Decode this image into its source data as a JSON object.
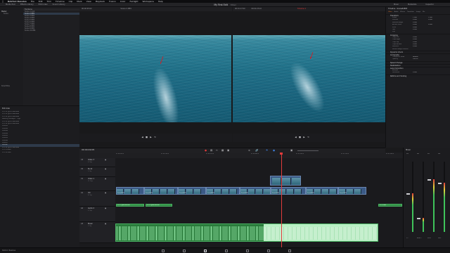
{
  "menubar": {
    "app_name": "DaVinci Resolve",
    "items": [
      "File",
      "Edit",
      "Trim",
      "Timeline",
      "Clip",
      "Mark",
      "View",
      "Playback",
      "Fusion",
      "Color",
      "Fairlight",
      "Workspace",
      "Help"
    ]
  },
  "toolbar": {
    "left": [
      "Media Pool",
      "Effects Library",
      "Edit Index",
      "Sound Library"
    ],
    "project_title": "My First Edit",
    "project_status": "Edited",
    "right": [
      "Mixer",
      "Metadata",
      "Inspector"
    ]
  },
  "media_pool": {
    "bins": [
      "Master",
      "Scene"
    ],
    "smart_bins_label": "Smart Bins",
    "column_header": "File Name",
    "clips": [
      "Scene 1.mp4",
      "Scene 2.MP4",
      "Scene 3.MP4",
      "Scene 4.MP4",
      "Scene 5.MP4",
      "Scene 6.MP4",
      "Scene 7.MP4",
      "Scene 8.MP4",
      "Scene 9.MP4",
      "Scene 10.MP4"
    ],
    "selected_index": 1
  },
  "edit_index": {
    "title": "Edit Index",
    "rows": [
      "PTC 01 good take.wav",
      "PTC 01 good take.wav",
      "PTC 02 good take.wav",
      "Leaving Verzegni - Trigo",
      "PTC 01 good take.wav",
      "PTC 02 good take.wav",
      "Scene3",
      "Scene2",
      "Scene6",
      "Scene4",
      "Scene5",
      "Scene1",
      "Scene8",
      "Scene7",
      "Shore1",
      "PTC 02 good take.wav",
      "PTC 03.wav",
      "PTC 01.wav"
    ],
    "selected_index": 14
  },
  "viewer": {
    "source_timecode": "00:00:05:02",
    "source_clip": "Scene 2.MP4",
    "program_timecode_left": "00:01:17:00",
    "program_timecode_right": "00:01:23:22",
    "program_label": "Timeline 1",
    "timeline_timecode": "00:00:49:05",
    "fit_zoom": "Fit"
  },
  "inspector": {
    "title": "Timeline - Scene6.MP4",
    "tabs": [
      "Video",
      "Audio",
      "Effects",
      "Transition",
      "Image",
      "File"
    ],
    "sections": [
      {
        "name": "Transform",
        "rows": [
          {
            "label": "Zoom",
            "x": "1.000",
            "y": "1.000"
          },
          {
            "label": "Position",
            "x": "0.000",
            "y": "0.000"
          },
          {
            "label": "Rotation Angle",
            "x": "0.000",
            "y": ""
          },
          {
            "label": "Anchor Point",
            "x": "0.000",
            "y": "0.000"
          },
          {
            "label": "Pitch",
            "x": "0.000",
            "y": ""
          },
          {
            "label": "Yaw",
            "x": "0.000",
            "y": ""
          },
          {
            "label": "Flip",
            "x": "",
            "y": ""
          }
        ]
      },
      {
        "name": "Cropping",
        "rows": [
          {
            "label": "Crop Left",
            "x": "0.000",
            "y": ""
          },
          {
            "label": "Crop Right",
            "x": "0.000",
            "y": ""
          },
          {
            "label": "Crop Top",
            "x": "0.000",
            "y": ""
          },
          {
            "label": "Crop Bottom",
            "x": "0.000",
            "y": ""
          },
          {
            "label": "Softness",
            "x": "0.000",
            "y": ""
          },
          {
            "label": "Retain Image Position",
            "x": "",
            "y": ""
          }
        ]
      },
      {
        "name": "Dynamic Zoom",
        "rows": []
      },
      {
        "name": "Composite",
        "rows": [
          {
            "label": "Composite Mode",
            "x": "Normal",
            "y": ""
          },
          {
            "label": "Opacity",
            "x": "100.00",
            "y": ""
          }
        ]
      },
      {
        "name": "Speed Change",
        "rows": []
      },
      {
        "name": "Stabilization",
        "rows": []
      },
      {
        "name": "Lens Correction",
        "rows": [
          {
            "label": "Analyze",
            "x": "",
            "y": ""
          },
          {
            "label": "Distortion",
            "x": "0.000",
            "y": ""
          }
        ]
      },
      {
        "name": "Retime and Scaling",
        "rows": []
      }
    ]
  },
  "timeline": {
    "ruler": [
      "01:00:00:00",
      "01:00:16:00",
      "01:00:32:00",
      "01:00:48:00",
      "01:01:04:00",
      "01:01:20:00",
      "01:01:36:00"
    ],
    "tracks": [
      {
        "id": "V3",
        "name": "Video 3",
        "clips": "0 Clips"
      },
      {
        "id": "V2",
        "name": "B-roll",
        "clips": "1 Clip"
      },
      {
        "id": "V1",
        "name": "Video 1",
        "clips": "12 Clips"
      },
      {
        "id": "A1",
        "name": "VO",
        "clips": "8 Clips"
      },
      {
        "id": "A2",
        "name": "Audio 2",
        "clips": "0 Clips"
      },
      {
        "id": "A3",
        "name": "Music",
        "clips": "1 Clip"
      }
    ],
    "video_clip_labels": [
      "Scene3.MP4",
      "Scene2.MP4",
      "Scene6.MP4",
      "Scene4.MP4",
      "Scene5.MP4",
      "Scene1.MP4",
      "Scene8.MP4",
      "Scene7.MP4"
    ],
    "audio_clip_labels": [
      "PTC 01 good take.wav",
      "PTC 02 good take.wav",
      "PTC 03.wav"
    ],
    "music_label": "Leaving Verzegni - Trigo"
  },
  "mixer": {
    "title": "Mixer",
    "channels": [
      "A1",
      "A2",
      "A3",
      "M1"
    ],
    "channel_names": [
      "VO",
      "Audio 2",
      "Music",
      "Main"
    ],
    "levels": [
      0.55,
      0.2,
      0.75,
      0.7
    ]
  },
  "pages": [
    "media",
    "cut",
    "edit",
    "fusion",
    "color",
    "fairlight",
    "deliver"
  ],
  "active_page_index": 2,
  "colors": {
    "accent": "#e0782a",
    "playhead": "#e23b3b",
    "video_clip": "#3b5a86",
    "audio_clip": "#2f8b43"
  }
}
